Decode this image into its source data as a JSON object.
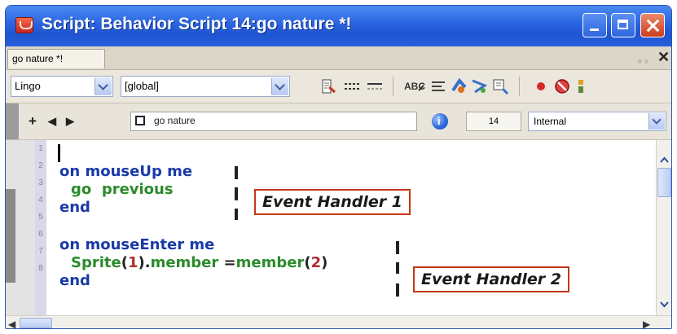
{
  "window": {
    "title": "Script: Behavior Script 14:go nature *!",
    "tab_label": "go nature *!"
  },
  "toolbar": {
    "language": "Lingo",
    "handler_scope": "[global]"
  },
  "infobar": {
    "member_name": "go nature",
    "line_count": "14",
    "scope": "Internal"
  },
  "editor": {
    "line_numbers": [
      "1",
      "2",
      "3",
      "4",
      "5",
      "6",
      "7",
      "8"
    ],
    "handler1": {
      "line1_on": "on",
      "line1_name": "mouseUp",
      "line1_arg": "me",
      "line2_cmd": "go",
      "line2_arg": "previous",
      "line3_end": "end"
    },
    "handler2": {
      "line1_on": "on",
      "line1_name": "mouseEnter",
      "line1_arg": "me",
      "line2_fn1": "Sprite",
      "line2_p1": "(",
      "line2_n1": "1",
      "line2_p2": ").",
      "line2_prop": "member",
      "line2_eq": " =",
      "line2_fn2": "member",
      "line2_p3": "(",
      "line2_n2": "2",
      "line2_p4": ")",
      "line3_end": "end"
    }
  },
  "callouts": {
    "first": "Event Handler 1",
    "second": "Event Handler 2"
  },
  "colors": {
    "title_bar": "#2a64e0",
    "keyword": "#1a3aa8",
    "function": "#2b8a2b",
    "number": "#b03030",
    "callout_border": "#c33818"
  }
}
